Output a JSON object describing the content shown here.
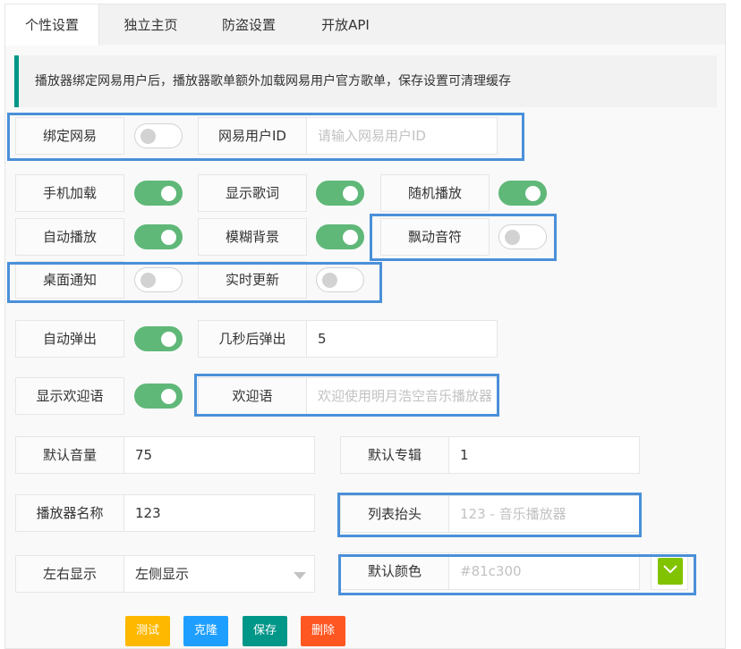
{
  "tabs": [
    {
      "label": "个性设置",
      "active": true
    },
    {
      "label": "独立主页",
      "active": false
    },
    {
      "label": "防盗设置",
      "active": false
    },
    {
      "label": "开放API",
      "active": false
    }
  ],
  "notice": "播放器绑定网易用户后，播放器歌单额外加载网易用户官方歌单，保存设置可清理缓存",
  "fields": {
    "bind_netease": {
      "label": "绑定网易",
      "on": false
    },
    "netease_uid": {
      "label": "网易用户ID",
      "value": "",
      "placeholder": "请输入网易用户ID"
    },
    "mobile_load": {
      "label": "手机加载",
      "on": true
    },
    "show_lyrics": {
      "label": "显示歌词",
      "on": true
    },
    "random_play": {
      "label": "随机播放",
      "on": true
    },
    "auto_play": {
      "label": "自动播放",
      "on": true
    },
    "blur_bg": {
      "label": "模糊背景",
      "on": true
    },
    "float_notes": {
      "label": "飘动音符",
      "on": false
    },
    "desktop_notify": {
      "label": "桌面通知",
      "on": false
    },
    "live_update": {
      "label": "实时更新",
      "on": false
    },
    "auto_popup": {
      "label": "自动弹出",
      "on": true
    },
    "popup_delay": {
      "label": "几秒后弹出",
      "value": "5"
    },
    "show_welcome": {
      "label": "显示欢迎语",
      "on": true
    },
    "welcome_text": {
      "label": "欢迎语",
      "value": "",
      "placeholder": "欢迎使用明月浩空音乐播放器"
    },
    "default_volume": {
      "label": "默认音量",
      "value": "75"
    },
    "default_album": {
      "label": "默认专辑",
      "value": "1"
    },
    "player_name": {
      "label": "播放器名称",
      "value": "123"
    },
    "list_header": {
      "label": "列表抬头",
      "value": "",
      "placeholder": "123 - 音乐播放器"
    },
    "side_display": {
      "label": "左右显示",
      "value": "左侧显示"
    },
    "default_color": {
      "label": "默认颜色",
      "value": "",
      "placeholder": "#81c300",
      "swatch": "#81c300"
    }
  },
  "buttons": {
    "test": {
      "label": "测试",
      "color": "#ffb800"
    },
    "clone": {
      "label": "克隆",
      "color": "#1e9fff"
    },
    "save": {
      "label": "保存",
      "color": "#009688"
    },
    "delete": {
      "label": "删除",
      "color": "#ff5722"
    }
  },
  "colors": {
    "switch_on": "#5fb878",
    "highlight": "#4a90d9",
    "notice_accent": "#009688"
  }
}
